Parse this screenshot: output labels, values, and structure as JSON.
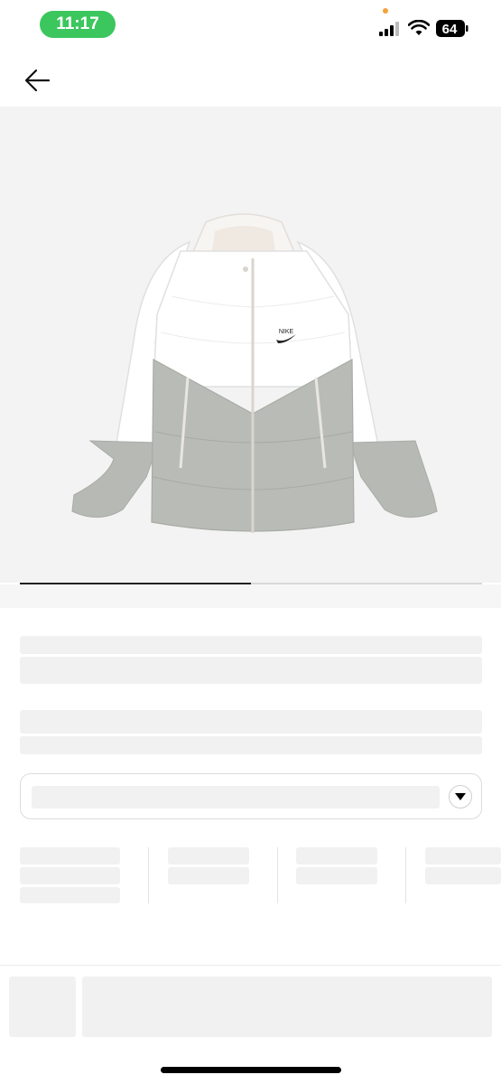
{
  "status_bar": {
    "time": "11:17",
    "battery_level": "64",
    "time_pill_color": "#3cc65e",
    "icons": [
      "signal-icon",
      "wifi-icon",
      "battery-icon"
    ]
  },
  "header": {
    "back_icon": "arrow-left-icon"
  },
  "gallery": {
    "product_image": "jacket-image",
    "product_logo_text": "NIKE",
    "carousel_progress": 0.5
  },
  "options": {
    "select_icon": "caret-down-icon"
  }
}
